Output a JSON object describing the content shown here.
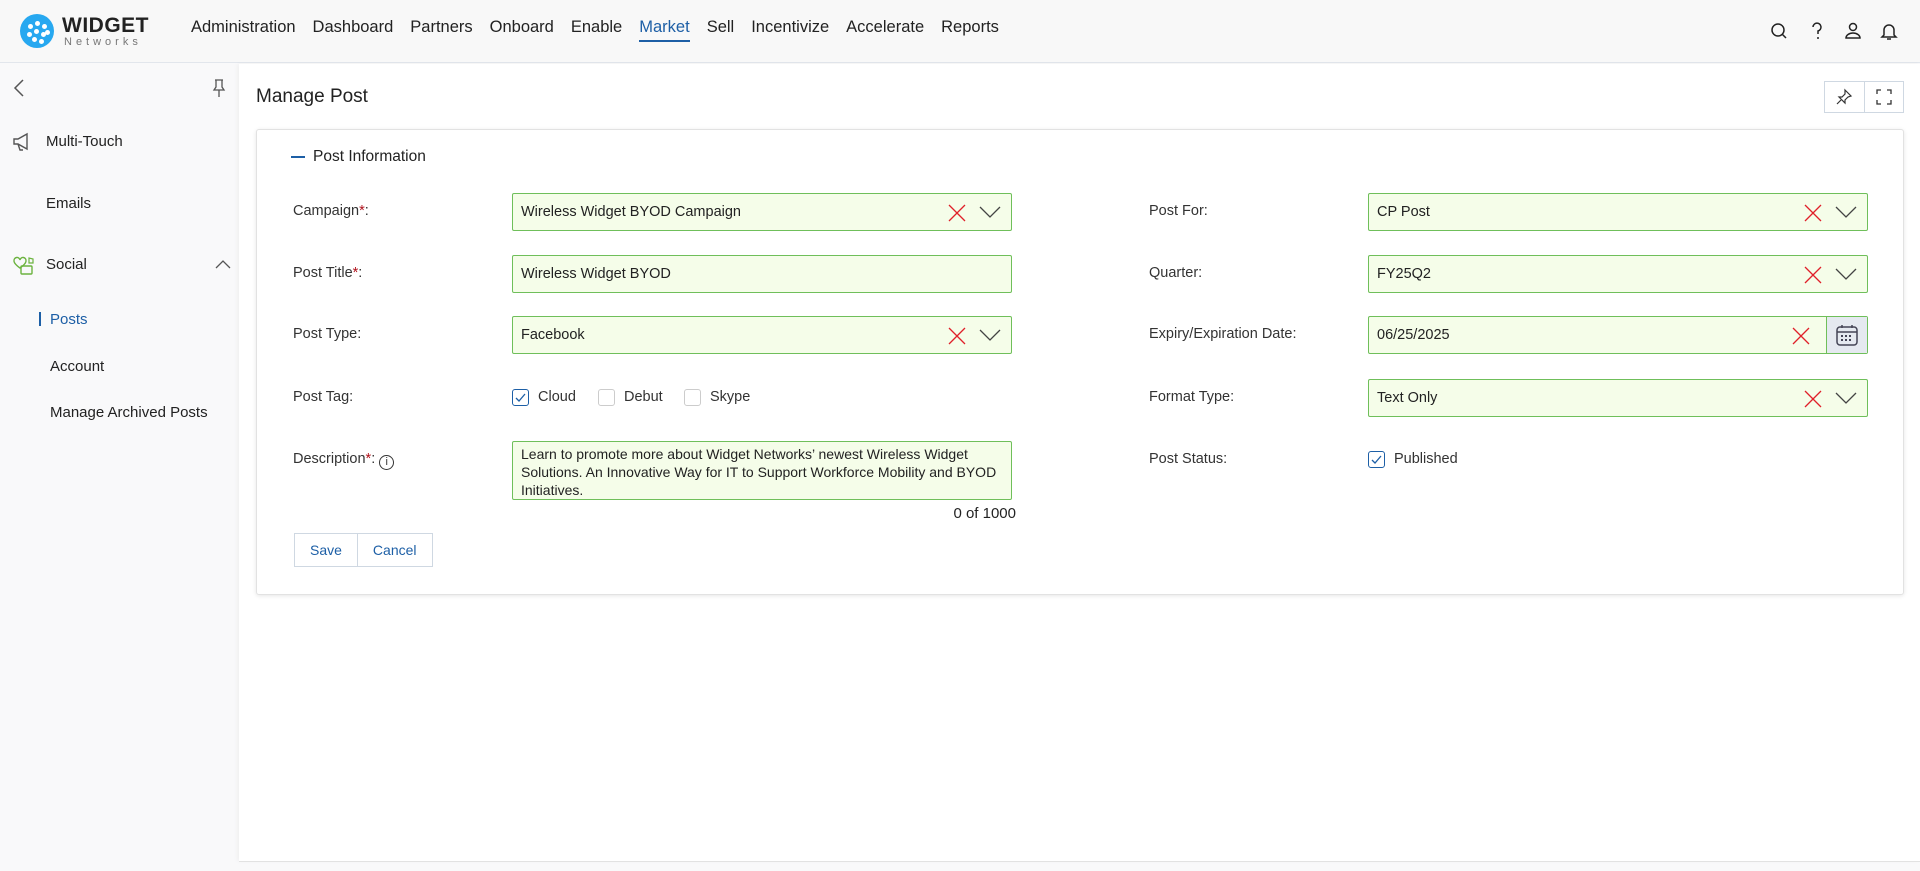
{
  "brand": {
    "name": "WIDGET",
    "sub": "Networks",
    "color": "#27a8f0"
  },
  "nav": {
    "items": [
      "Administration",
      "Dashboard",
      "Partners",
      "Onboard",
      "Enable",
      "Market",
      "Sell",
      "Incentivize",
      "Accelerate",
      "Reports"
    ],
    "active": "Market"
  },
  "header_icons": [
    "search-icon",
    "help-icon",
    "user-icon",
    "bell-icon"
  ],
  "sidebar": {
    "multi_touch": "Multi-Touch",
    "emails": "Emails",
    "social": "Social",
    "posts": "Posts",
    "account": "Account",
    "archived": "Manage Archived Posts"
  },
  "page": {
    "title": "Manage Post",
    "section": "Post Information"
  },
  "form": {
    "campaign": {
      "label": "Campaign",
      "value": "Wireless Widget BYOD Campaign"
    },
    "post_title": {
      "label": "Post Title",
      "value": "Wireless Widget BYOD"
    },
    "post_type": {
      "label": "Post Type:",
      "value": "Facebook"
    },
    "post_tag": {
      "label": "Post Tag:",
      "options": [
        {
          "label": "Cloud",
          "checked": true
        },
        {
          "label": "Debut",
          "checked": false
        },
        {
          "label": "Skype",
          "checked": false
        }
      ]
    },
    "description": {
      "label": "Description",
      "value": "Learn to promote more about Widget Networks’ newest Wireless Widget Solutions. An Innovative Way for IT to Support Workforce Mobility and BYOD Initiatives.",
      "counter": "0 of 1000"
    },
    "post_for": {
      "label": "Post For:",
      "value": "CP Post"
    },
    "quarter": {
      "label": "Quarter:",
      "value": "FY25Q2"
    },
    "expiry": {
      "label": "Expiry/Expiration Date:",
      "value": "06/25/2025"
    },
    "format_type": {
      "label": "Format Type:",
      "value": "Text Only"
    },
    "post_status": {
      "label": "Post Status:",
      "option": "Published",
      "checked": true
    },
    "required_mark": "*",
    "colon": ":"
  },
  "buttons": {
    "save": "Save",
    "cancel": "Cancel"
  },
  "colors": {
    "accent": "#1d5fa6",
    "field_bg": "#f5fde9",
    "field_border": "#6fbf5a",
    "clear": "#e0202a"
  }
}
